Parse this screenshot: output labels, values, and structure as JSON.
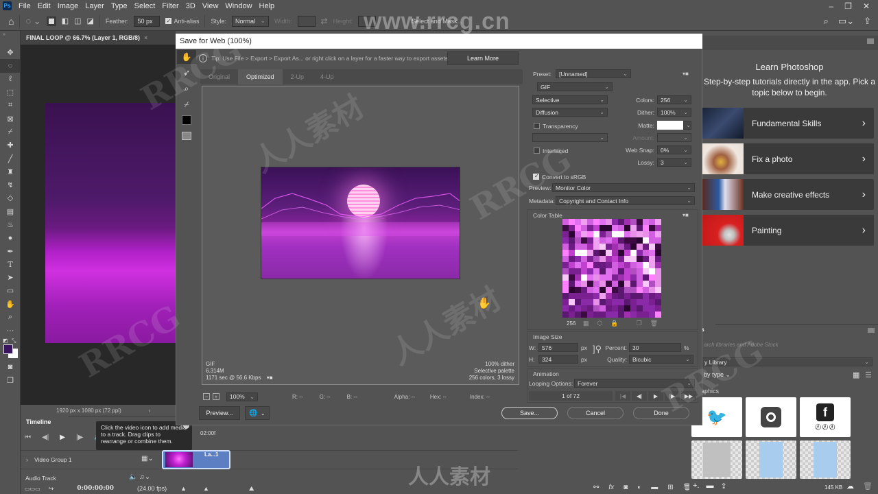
{
  "app": {
    "logo": "Ps",
    "menu": [
      "File",
      "Edit",
      "Image",
      "Layer",
      "Type",
      "Select",
      "Filter",
      "3D",
      "View",
      "Window",
      "Help"
    ],
    "window_controls": [
      "minimize",
      "restore",
      "close"
    ]
  },
  "options_bar": {
    "feather_label": "Feather:",
    "feather_value": "50 px",
    "antialias_label": "Anti-alias",
    "antialias_checked": true,
    "style_label": "Style:",
    "style_value": "Normal",
    "width_label": "Width:",
    "height_label": "Height:",
    "select_mask_label": "Select and Mask..."
  },
  "document": {
    "tab_title": "FINAL LOOP @ 66.7% (Layer 1, RGB/8)",
    "status": "1920 px x 1080 px (72 ppi)"
  },
  "tools": [
    "move",
    "elliptical-marquee",
    "lasso",
    "object-selection",
    "crop",
    "frame",
    "eyedropper",
    "healing-brush",
    "brush",
    "clone-stamp",
    "history-brush",
    "eraser",
    "gradient",
    "blur",
    "dodge",
    "pen",
    "type",
    "path-selection",
    "rectangle",
    "hand",
    "zoom",
    "more"
  ],
  "colors": {
    "foreground": "#3a1460",
    "background": "#ffffff",
    "accent": "#31a8ff"
  },
  "timeline": {
    "tab": "Timeline",
    "timecode_marker": "02:00f",
    "tooltip": "Click the video icon to add media to a track. Drag clips to rearrange or combine them.",
    "video_group": "Video Group 1",
    "clip_label": "La...1",
    "audio_track": "Audio Track",
    "current_time": "0:00:00:00",
    "fps": "(24.00 fps)"
  },
  "dialog": {
    "title": "Save for Web (100%)",
    "tip": "Tip: Use File > Export > Export As...  or right click on a layer for a faster way to export assets",
    "learn_more": "Learn More",
    "tabs": [
      {
        "label": "Original",
        "active": false
      },
      {
        "label": "Optimized",
        "active": true
      },
      {
        "label": "2-Up",
        "active": false
      },
      {
        "label": "4-Up",
        "active": false
      }
    ],
    "preview_info_left": [
      "GIF",
      "6.314M",
      "1171 sec @ 56.6 Kbps"
    ],
    "preview_info_right": [
      "100% dither",
      "Selective palette",
      "256 colors, 3 lossy"
    ],
    "zoom_value": "100%",
    "status": {
      "r": "R: --",
      "g": "G: --",
      "b": "B: --",
      "alpha": "Alpha: --",
      "hex": "Hex: --",
      "index": "Index: --"
    },
    "preview_button": "Preview...",
    "save_button": "Save...",
    "cancel_button": "Cancel",
    "done_button": "Done",
    "settings": {
      "preset_label": "Preset:",
      "preset_value": "[Unnamed]",
      "format": "GIF",
      "reduction": "Selective",
      "dither_algo": "Diffusion",
      "transparency_label": "Transparency",
      "transparency_checked": false,
      "interlaced_label": "Interlaced",
      "interlaced_checked": false,
      "colors_label": "Colors:",
      "colors_value": "256",
      "dither_label": "Dither:",
      "dither_value": "100%",
      "matte_label": "Matte:",
      "matte_color": "#ffffff",
      "amount_label": "Amount:",
      "websnap_label": "Web Snap:",
      "websnap_value": "0%",
      "lossy_label": "Lossy:",
      "lossy_value": "3",
      "convert_srgb_label": "Convert to sRGB",
      "convert_srgb_checked": true,
      "preview_label": "Preview:",
      "preview_value": "Monitor Color",
      "metadata_label": "Metadata:",
      "metadata_value": "Copyright and Contact Info",
      "color_table_label": "Color Table",
      "color_count": "256",
      "image_size_label": "Image Size",
      "w_label": "W:",
      "w_value": "576",
      "h_label": "H:",
      "h_value": "324",
      "px": "px",
      "percent_label": "Percent:",
      "percent_value": "30",
      "percent_unit": "%",
      "quality_label": "Quality:",
      "quality_value": "Bicubic",
      "animation_label": "Animation",
      "looping_label": "Looping Options:",
      "looping_value": "Forever",
      "frame_counter": "1 of 72"
    }
  },
  "learn_panel": {
    "title": "Learn Photoshop",
    "description": "Step-by-step tutorials directly in the app. Pick a topic below to begin.",
    "cards": [
      {
        "label": "Fundamental Skills"
      },
      {
        "label": "Fix a photo"
      },
      {
        "label": "Make creative effects"
      },
      {
        "label": "Painting"
      }
    ]
  },
  "libraries": {
    "tab": "aries",
    "search_placeholder": "arch libraries and Adobe Stock",
    "library": "y Library",
    "group_by": "by type",
    "section": "aphics",
    "size": "145 KB"
  },
  "watermarks": [
    "www.rrcg.cn",
    "RRCG",
    "人人素材"
  ]
}
